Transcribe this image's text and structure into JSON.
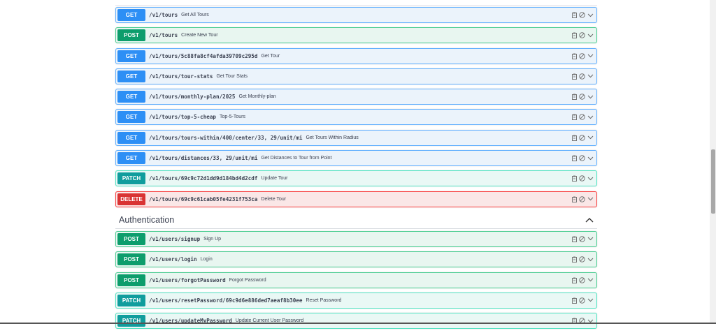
{
  "tours_ops": [
    {
      "method": "GET",
      "path": "/v1/tours",
      "summary": "Get All Tours"
    },
    {
      "method": "POST",
      "path": "/v1/tours",
      "summary": "Create New Tour"
    },
    {
      "method": "GET",
      "path": "/v1/tours/5c88fa8cf4afda39709c295d",
      "summary": "Get Tour"
    },
    {
      "method": "GET",
      "path": "/v1/tours/tour-stats",
      "summary": "Get Tour Stats"
    },
    {
      "method": "GET",
      "path": "/v1/tours/monthly-plan/2025",
      "summary": "Get Monthly-plan"
    },
    {
      "method": "GET",
      "path": "/v1/tours/top-5-cheap",
      "summary": "Top-5-Tours"
    },
    {
      "method": "GET",
      "path": "/v1/tours/tours-within/400/center/33, 29/unit/mi",
      "summary": "Get Tours Within Radius"
    },
    {
      "method": "GET",
      "path": "/v1/tours/distances/33, 29/unit/mi",
      "summary": "Get Distances to Tour from Point"
    },
    {
      "method": "PATCH",
      "path": "/v1/tours/69c9c72d1dd9d184bd4d2cdf",
      "summary": "Update Tour"
    },
    {
      "method": "DELETE",
      "path": "/v1/tours/69c9c61cab05fe4231f753ca",
      "summary": "Delete Tour"
    }
  ],
  "auth_section": {
    "title": "Authentication"
  },
  "auth_ops": [
    {
      "method": "POST",
      "path": "/v1/users/signup",
      "summary": "Sign Up"
    },
    {
      "method": "POST",
      "path": "/v1/users/login",
      "summary": "Login"
    },
    {
      "method": "POST",
      "path": "/v1/users/forgotPassword",
      "summary": "Forgot Password"
    },
    {
      "method": "PATCH",
      "path": "/v1/users/resetPassword/69c9d6e886ded7aeaf8b30ee",
      "summary": "Reset Password"
    },
    {
      "method": "PATCH",
      "path": "/v1/users/updateMyPassword",
      "summary": "Update Current User Password"
    }
  ]
}
